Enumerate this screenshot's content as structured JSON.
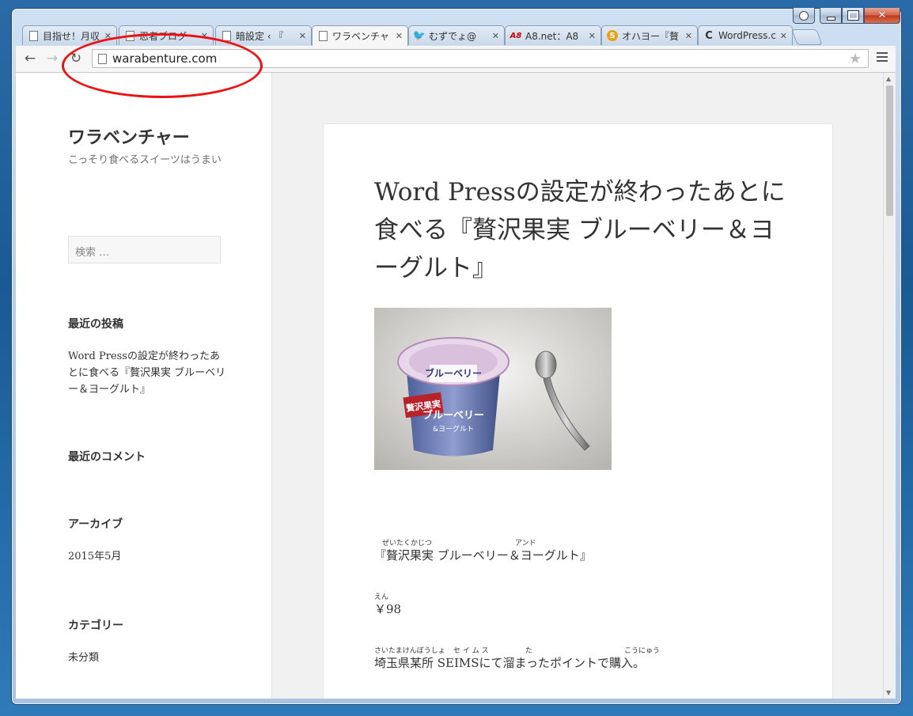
{
  "tabs": [
    {
      "title": "目指せ！月収",
      "icon": "document-icon"
    },
    {
      "title": "忍者ブログ",
      "icon": "document-icon"
    },
    {
      "title": "暗設定 ‹ 『",
      "icon": "document-icon"
    },
    {
      "title": "ワラベンチャ",
      "icon": "document-icon",
      "active": true
    },
    {
      "title": "むずでょ@",
      "icon": "twitter-icon"
    },
    {
      "title": "A8.net：A8",
      "icon": "a8-icon"
    },
    {
      "title": "オハヨー『贅",
      "icon": "s-icon"
    },
    {
      "title": "WordPress.c",
      "icon": "wordpress-icon"
    }
  ],
  "toolbar": {
    "url": "warabenture.com"
  },
  "sidebar": {
    "site_title": "ワラベンチャー",
    "tagline": "こっそり食べるスイーツはうまい",
    "search_placeholder": "検索 …",
    "recent_posts_title": "最近の投稿",
    "recent_post_1": "Word Pressの設定が終わったあとに食べる『贅沢果実 ブルーベリー＆ヨーグルト』",
    "recent_comments_title": "最近のコメント",
    "archives_title": "アーカイブ",
    "archive_1": "2015年5月",
    "categories_title": "カテゴリー",
    "category_1": "未分類"
  },
  "post": {
    "title": "Word Pressの設定が終わったあとに食べる『贅沢果実 ブルーベリー＆ヨーグルト』",
    "photo_label_1": "贅沢果実",
    "photo_label_2": "ブルーベリー",
    "photo_label_3": "&ヨーグルト",
    "line1": {
      "ruby_a": "ぜいたくかじつ",
      "ruby_b": "アンド",
      "text": "『贅沢果実 ブルーベリー＆ヨーグルト』"
    },
    "line2": {
      "ruby_a": "えん",
      "text": "￥98"
    },
    "line3": {
      "ruby_a": "さいたまけんぼうしょ",
      "ruby_b": "セ イ ム ス",
      "ruby_c": "た",
      "ruby_d": "こうにゅう",
      "text": "埼玉県某所 SEIMSにて溜まったポイントで購入。"
    }
  }
}
